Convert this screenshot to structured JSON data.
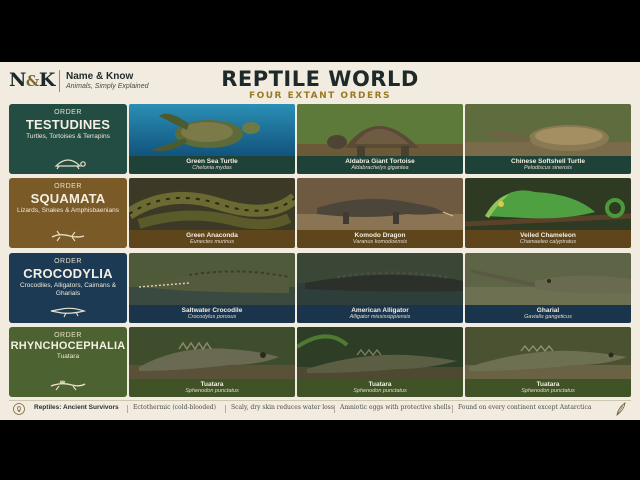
{
  "brand": {
    "logo_left": "N",
    "logo_amp": "&",
    "logo_right": "K",
    "name": "Name & Know",
    "tagline": "Animals, Simply Explained"
  },
  "header": {
    "title": "REPTILE WORLD",
    "subtitle": "FOUR EXTANT ORDERS"
  },
  "colors": {
    "testudines": "#234d43",
    "squamata": "#7a5a26",
    "crocodylia": "#1d3a55",
    "rhynchocephalia": "#4c6230",
    "title_accent": "#9a7a22"
  },
  "orders": [
    {
      "label": "ORDER",
      "name": "TESTUDINES",
      "desc": "Turtles, Tortoises & Terrapins",
      "icon": "turtle-icon",
      "species": [
        {
          "common": "Green Sea Turtle",
          "scientific": "Chelonia mydas"
        },
        {
          "common": "Aldabra Giant Tortoise",
          "scientific": "Aldabrachelys gigantea"
        },
        {
          "common": "Chinese Softshell Turtle",
          "scientific": "Pelodiscus sinensis"
        }
      ]
    },
    {
      "label": "ORDER",
      "name": "SQUAMATA",
      "desc": "Lizards, Snakes & Amphisbaenians",
      "icon": "lizard-icon",
      "species": [
        {
          "common": "Green Anaconda",
          "scientific": "Eunectes murinus"
        },
        {
          "common": "Komodo Dragon",
          "scientific": "Varanus komodoensis"
        },
        {
          "common": "Veiled Chameleon",
          "scientific": "Chamaeleo calyptratus"
        }
      ]
    },
    {
      "label": "ORDER",
      "name": "CROCODYLIA",
      "desc": "Crocodiles, Alligators, Caimans & Gharials",
      "icon": "crocodile-icon",
      "species": [
        {
          "common": "Saltwater Crocodile",
          "scientific": "Crocodylus porosus"
        },
        {
          "common": "American Alligator",
          "scientific": "Alligator mississippiensis"
        },
        {
          "common": "Gharial",
          "scientific": "Gavialis gangeticus"
        }
      ]
    },
    {
      "label": "ORDER",
      "name": "RHYNCHOCEPHALIA",
      "desc": "Tuatara",
      "icon": "tuatara-icon",
      "species": [
        {
          "common": "Tuatara",
          "scientific": "Sphenodon punctatus"
        },
        {
          "common": "Tuatara",
          "scientific": "Sphenodon punctatus"
        },
        {
          "common": "Tuatara",
          "scientific": "Sphenodon punctatus"
        }
      ]
    }
  ],
  "footer": {
    "heading": "Reptiles: Ancient Survivors",
    "facts": [
      "Ectothermic (cold-blooded)",
      "Scaly, dry skin reduces water loss",
      "Amniotic eggs with protective shells",
      "Found on every continent except Antarctica"
    ]
  }
}
